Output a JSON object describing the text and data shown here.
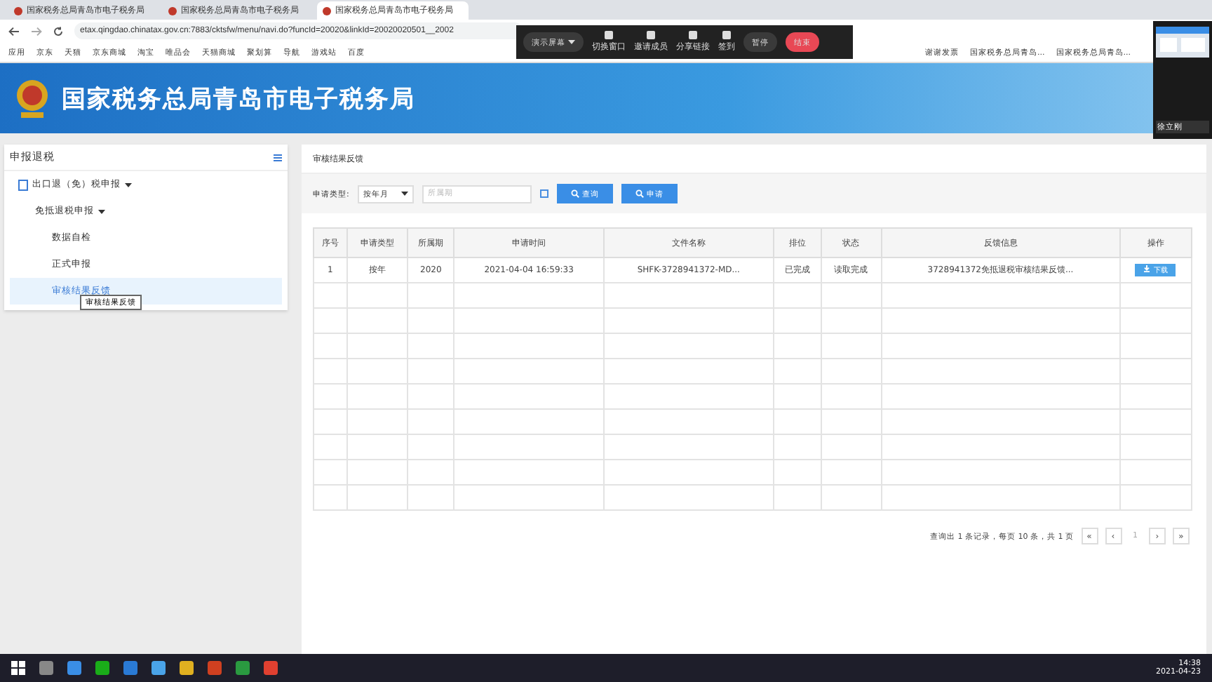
{
  "browser_tabs": [
    {
      "title": "国家税务总局青岛市电子税务局",
      "selected": false
    },
    {
      "title": "国家税务总局青岛市电子税务局",
      "selected": false
    },
    {
      "title": "国家税务总局青岛市电子税务局",
      "selected": true
    }
  ],
  "address": "etax.qingdao.chinatax.gov.cn:7883/cktsfw/menu/navi.do?funcId=20020&linkId=20020020501__2002",
  "bookmarks": [
    "应用",
    "京东",
    "天猫",
    "京东商城",
    "淘宝",
    "唯品会",
    "天猫商城",
    "聚划算",
    "导航",
    "游戏站",
    "百度"
  ],
  "bookmarks_right": [
    "谢谢发票",
    "国家税务总局青岛...",
    "国家税务总局青岛..."
  ],
  "meeting_toolbar": {
    "screen": "演示屏幕",
    "actions": [
      "切换窗口",
      "邀请成员",
      "分享链接",
      "签到"
    ],
    "pause": "暂停",
    "end": "结束"
  },
  "video": {
    "name": "徐立刚"
  },
  "banner": {
    "title": "国家税务总局青岛市电子税务局"
  },
  "sidebar": {
    "title": "申报退税",
    "items": [
      {
        "label": "出口退（免）税申报",
        "expanded": true,
        "children": [
          {
            "label": "免抵退税申报",
            "expanded": true,
            "children": [
              {
                "label": "数据自检",
                "selected": false
              },
              {
                "label": "正式申报",
                "selected": false
              },
              {
                "label": "审核结果反馈",
                "selected": true
              }
            ]
          }
        ]
      }
    ],
    "tooltip": "审核结果反馈"
  },
  "main": {
    "breadcrumb": "审核结果反馈",
    "filter": {
      "label": "申请类型:",
      "select": "按年月",
      "period_placeholder": "所属期",
      "buttons": [
        "查询",
        "申请"
      ]
    },
    "table": {
      "columns": [
        "序号",
        "申请类型",
        "所属期",
        "申请时间",
        "文件名称",
        "排位",
        "状态",
        "反馈信息",
        "操作"
      ],
      "rows": [
        [
          "1",
          "按年",
          "2020",
          "2021-04-04 16:59:33",
          "SHFK-3728941372-MD...",
          "已完成",
          "读取完成",
          "3728941372免抵退税审核结果反馈...",
          "下载"
        ]
      ]
    },
    "pagination": {
      "summary": "查询出 1 条记录，每页 10 条，共 1 页",
      "first": "«",
      "prev": "‹",
      "page": "1",
      "next": "›",
      "last": "»"
    }
  },
  "taskbar": {
    "time": "14:38",
    "date": "2021-04-23"
  }
}
